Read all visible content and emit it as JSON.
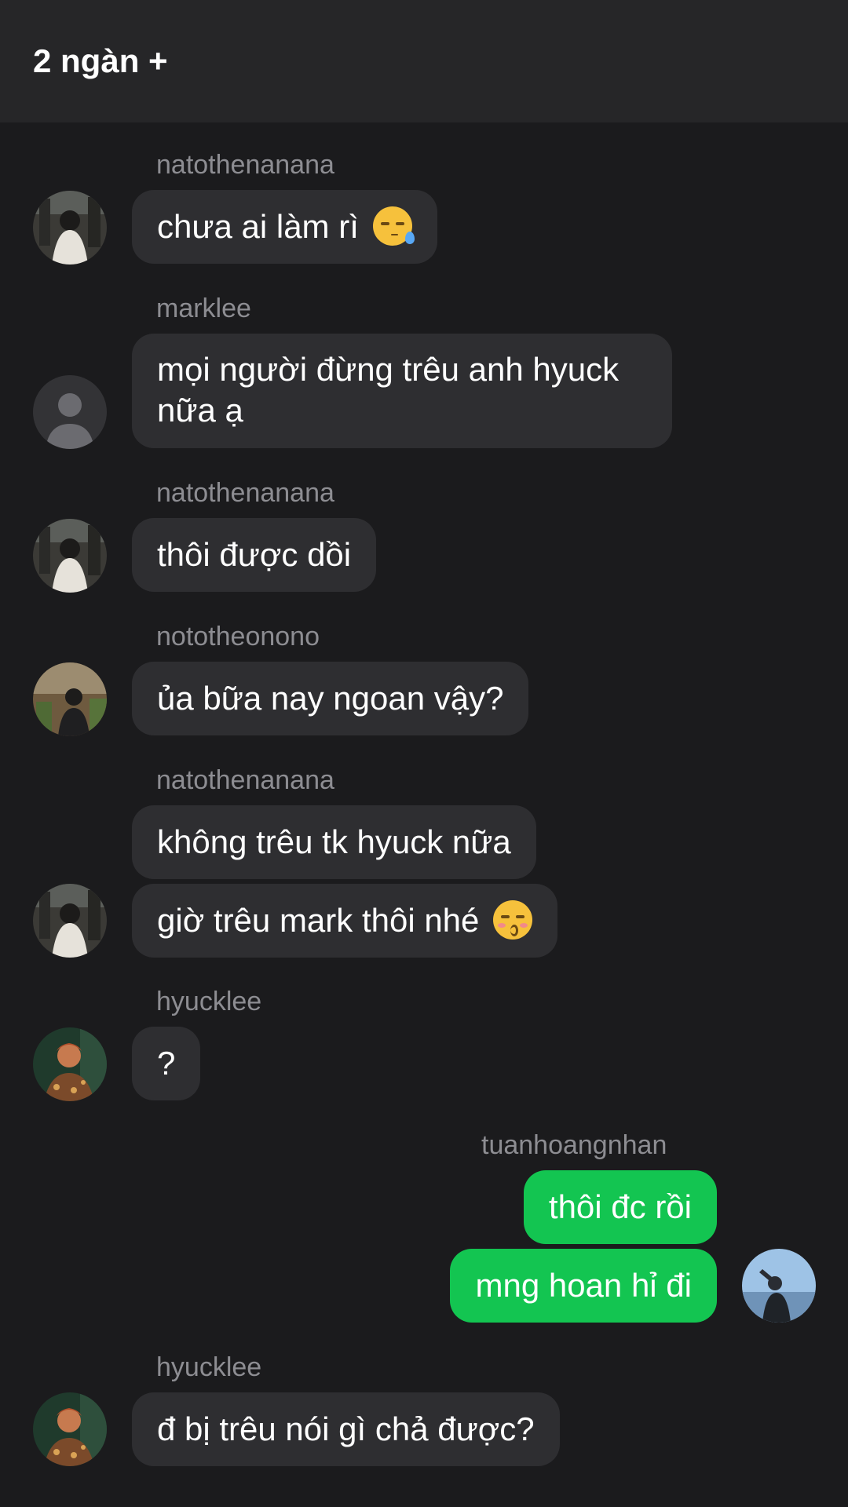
{
  "header": {
    "title": "2 ngàn +"
  },
  "messages": [
    {
      "sender": "natothenanana",
      "bubbles": [
        "chưa ai làm rì"
      ],
      "emoji": "sleepy-face-emoji"
    },
    {
      "sender": "marklee",
      "bubbles": [
        "mọi người đừng trêu anh hyuck nữa ạ"
      ]
    },
    {
      "sender": "natothenanana",
      "bubbles": [
        "thôi được dồi"
      ]
    },
    {
      "sender": "nototheonono",
      "bubbles": [
        "ủa bữa nay ngoan vậy?"
      ]
    },
    {
      "sender": "natothenanana",
      "bubbles": [
        "không trêu tk hyuck nữa",
        "giờ trêu mark thôi nhé"
      ],
      "emoji": "kissing-face-emoji"
    },
    {
      "sender": "hyucklee",
      "bubbles": [
        "?"
      ]
    },
    {
      "sender": "tuanhoangnhan",
      "bubbles": [
        "thôi đc rồi",
        "mng hoan hỉ đi"
      ],
      "is_me": true
    },
    {
      "sender": "hyucklee",
      "bubbles": [
        "đ bị trêu nói gì chả được?"
      ]
    }
  ],
  "colors": {
    "background": "#1b1b1d",
    "header": "#262628",
    "bubble": "#2e2e31",
    "my_bubble": "#13c551",
    "name": "#8d8d92"
  }
}
